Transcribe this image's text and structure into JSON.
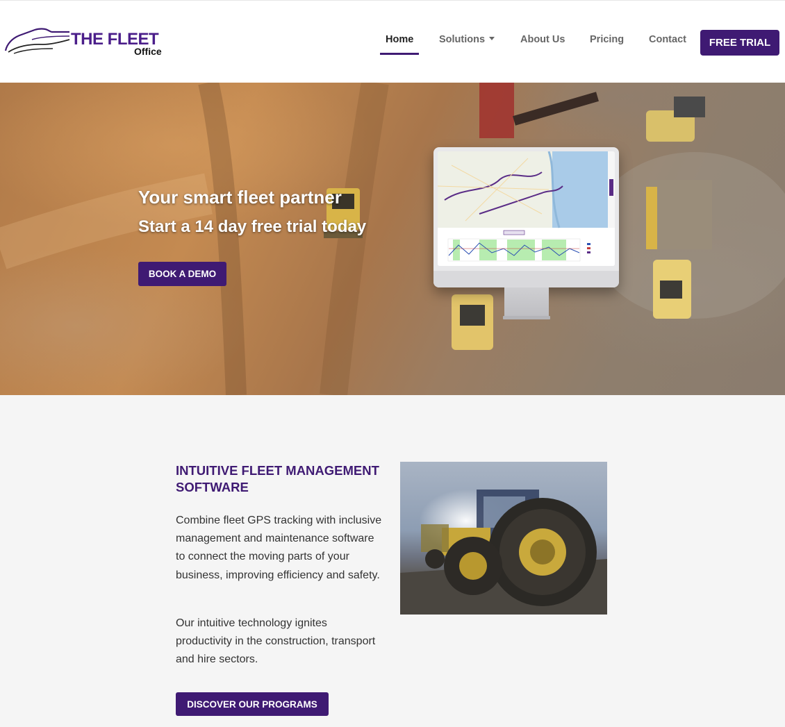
{
  "brand": {
    "logo_main": "THE FLEET",
    "logo_sub": "Office",
    "primary_color": "#3f1a73"
  },
  "nav": {
    "items": [
      {
        "label": "Home",
        "active": true
      },
      {
        "label": "Solutions",
        "dropdown": true
      },
      {
        "label": "About Us"
      },
      {
        "label": "Pricing"
      },
      {
        "label": "Contact"
      }
    ],
    "cta_label": "FREE TRIAL"
  },
  "hero": {
    "title": "Your smart fleet partner",
    "subtitle": "Start a 14 day free trial today",
    "cta_label": "BOOK A DEMO"
  },
  "intro": {
    "heading": "INTUITIVE FLEET MANAGEMENT SOFTWARE",
    "paragraph_1": "Combine fleet GPS tracking with inclusive management and maintenance software to connect the moving parts of your business, improving efficiency and safety.",
    "paragraph_2": "Our intuitive technology ignites productivity in the construction, transport and hire sectors.",
    "cta_label": "DISCOVER OUR PROGRAMS"
  }
}
